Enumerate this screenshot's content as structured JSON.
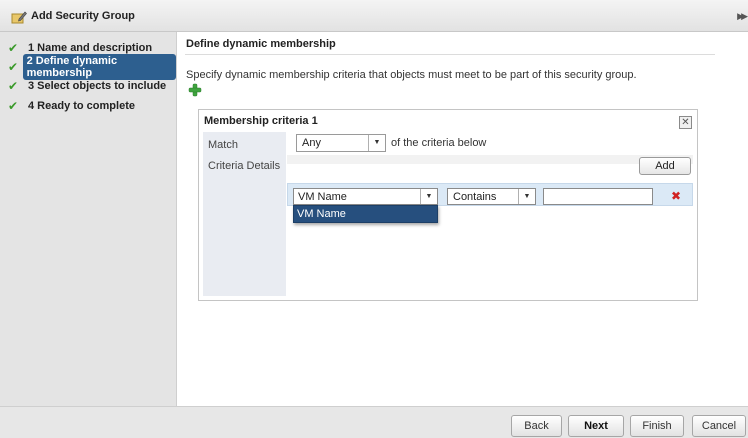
{
  "window": {
    "title": "Add Security Group",
    "title_icon": "edit-security-group-icon",
    "collapse_icon": "double-chevron-right-icon"
  },
  "steps": [
    {
      "number": "1",
      "label": "Name and description",
      "completed": true,
      "active": false
    },
    {
      "number": "2",
      "label": "Define dynamic membership",
      "completed": true,
      "active": true
    },
    {
      "number": "3",
      "label": "Select objects to include",
      "completed": true,
      "active": false
    },
    {
      "number": "4",
      "label": "Ready to complete",
      "completed": true,
      "active": false
    }
  ],
  "step_labels": {
    "s1": "1  Name and description",
    "s2": "2  Define dynamic membership",
    "s3": "3  Select objects to include",
    "s4": "4  Ready to complete"
  },
  "main": {
    "section_title": "Define dynamic membership",
    "description": "Specify dynamic membership criteria that objects must meet to be part of this security group.",
    "add_criteria_icon": "green-plus-icon"
  },
  "criteria": {
    "title": "Membership criteria 1",
    "match_label": "Match",
    "match_value": "Any",
    "match_suffix": "of the criteria below",
    "criteria_details_label": "Criteria Details",
    "add_label": "Add",
    "row": {
      "attribute": "VM Name",
      "operator": "Contains",
      "value": ""
    },
    "dropdown_options": [
      "VM Name"
    ]
  },
  "footer": {
    "back": "Back",
    "next": "Next",
    "finish": "Finish",
    "cancel": "Cancel"
  },
  "colors": {
    "active_step_bg": "#2d5f8f",
    "check_green": "#3a9a2a",
    "remove_red": "#d02222",
    "dropdown_highlight": "#264f7e"
  }
}
